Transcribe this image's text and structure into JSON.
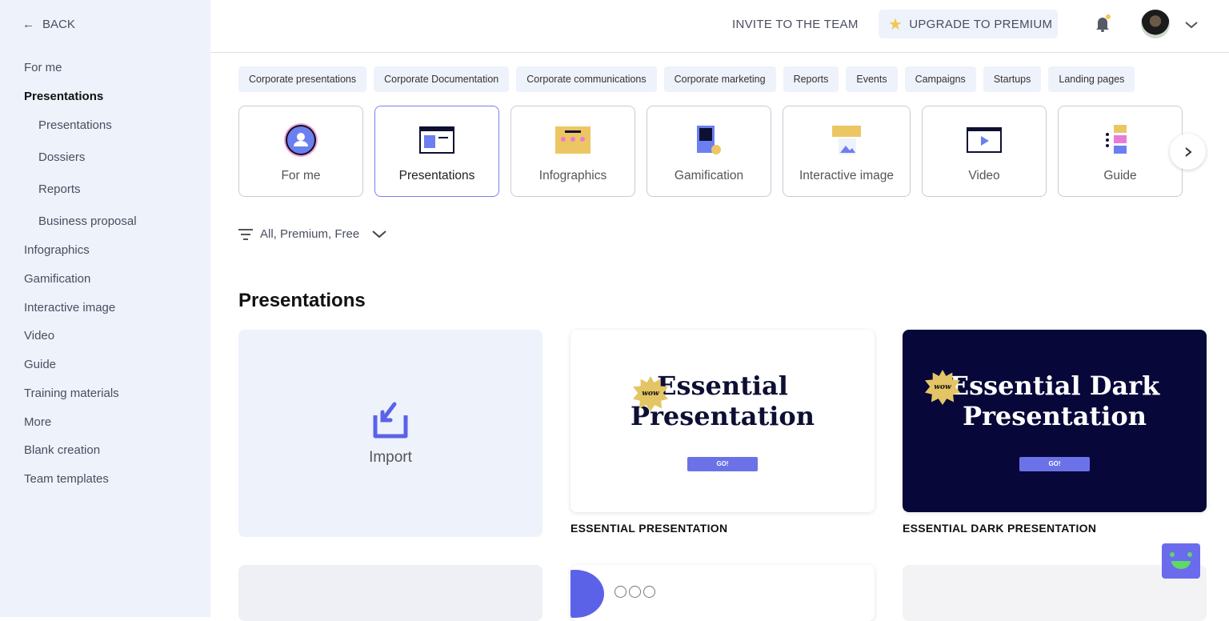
{
  "sidebar": {
    "back": "BACK",
    "items": [
      {
        "label": "For me"
      },
      {
        "label": "Presentations"
      },
      {
        "label": "Presentations"
      },
      {
        "label": "Dossiers"
      },
      {
        "label": "Reports"
      },
      {
        "label": "Business proposal"
      },
      {
        "label": "Infographics"
      },
      {
        "label": "Gamification"
      },
      {
        "label": "Interactive image"
      },
      {
        "label": "Video"
      },
      {
        "label": "Guide"
      },
      {
        "label": "Training materials"
      },
      {
        "label": "More"
      },
      {
        "label": "Blank creation"
      },
      {
        "label": "Team templates"
      }
    ]
  },
  "header": {
    "invite": "INVITE TO THE TEAM",
    "upgrade": "UPGRADE TO PREMIUM",
    "accent": "#f2c94c"
  },
  "chips": [
    "Corporate presentations",
    "Corporate Documentation",
    "Corporate communications",
    "Corporate marketing",
    "Reports",
    "Events",
    "Campaigns",
    "Startups",
    "Landing pages"
  ],
  "categories": [
    "For me",
    "Presentations",
    "Infographics",
    "Gamification",
    "Interactive image",
    "Video",
    "Guide"
  ],
  "filter": "All, Premium, Free",
  "section_title": "Presentations",
  "import_label": "Import",
  "templates": [
    {
      "title_line1": "Essential",
      "title_line2": "Presentation",
      "badge": "wow",
      "button": "GO!",
      "name": "ESSENTIAL PRESENTATION"
    },
    {
      "title_line1": "Essential Dark",
      "title_line2": "Presentation",
      "badge": "wow",
      "button": "GO!",
      "name": "ESSENTIAL DARK PRESENTATION"
    }
  ]
}
